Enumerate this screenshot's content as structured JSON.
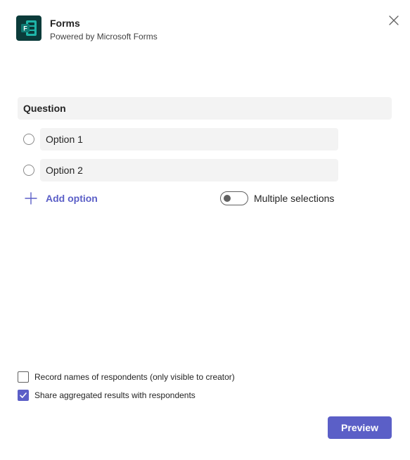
{
  "header": {
    "title": "Forms",
    "subtitle": "Powered by Microsoft Forms",
    "app_icon": "forms-app-icon",
    "close_icon": "close-icon"
  },
  "question": {
    "placeholder": "Question"
  },
  "options": [
    {
      "label": "Option 1"
    },
    {
      "label": "Option 2"
    }
  ],
  "add_option": {
    "label": "Add option",
    "icon": "plus-icon"
  },
  "multiple_selections": {
    "label": "Multiple selections",
    "enabled": false
  },
  "settings": {
    "record_names": {
      "label": "Record names of respondents (only visible to creator)",
      "checked": false
    },
    "share_results": {
      "label": "Share aggregated results with respondents",
      "checked": true
    }
  },
  "footer": {
    "preview_label": "Preview"
  },
  "colors": {
    "accent": "#5b5fc7",
    "input_bg": "#f3f3f3",
    "app_icon_bg": "#0b3b3a",
    "app_icon_teal": "#1fb5a8"
  }
}
